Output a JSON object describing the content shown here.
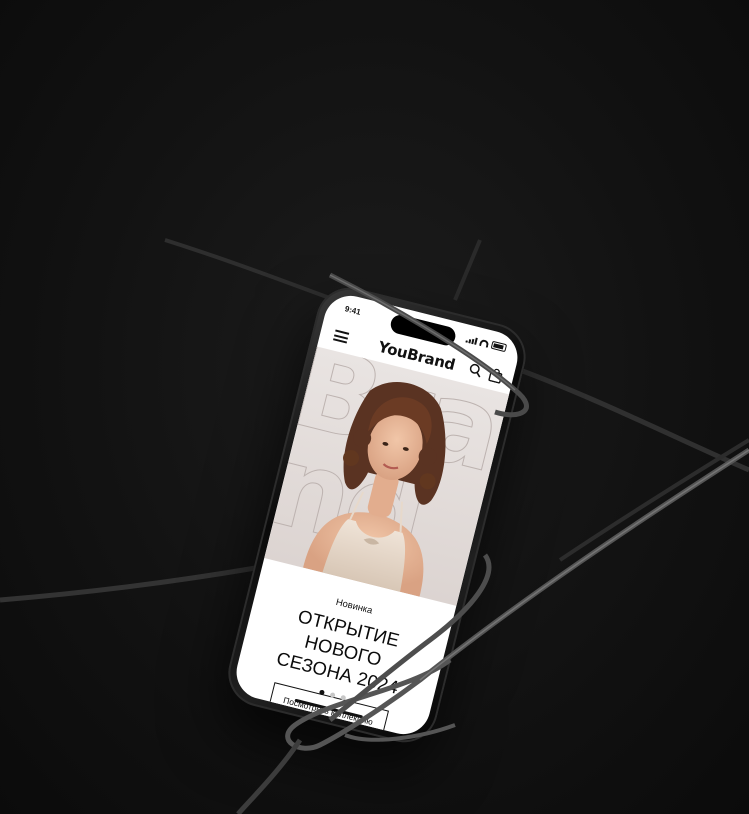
{
  "status_bar": {
    "time": "9:41"
  },
  "header": {
    "brand": "YouBrand",
    "icons": [
      "menu-icon",
      "search-icon",
      "bag-icon"
    ]
  },
  "hero": {
    "watermark": "Bra\nnd",
    "image": "woman-portrait"
  },
  "promo": {
    "tag": "Новинка",
    "headline_line1": "ОТКРЫТИЕ НОВОГО",
    "headline_line2": "СЕЗОНА 2024",
    "cta_label": "Посмотреть коллекцию"
  },
  "carousel": {
    "slides": 3,
    "active_index": 0
  },
  "colors": {
    "background": "#121212",
    "screen": "#ffffff",
    "hero_bg": "#e4dedb",
    "text": "#111111"
  }
}
